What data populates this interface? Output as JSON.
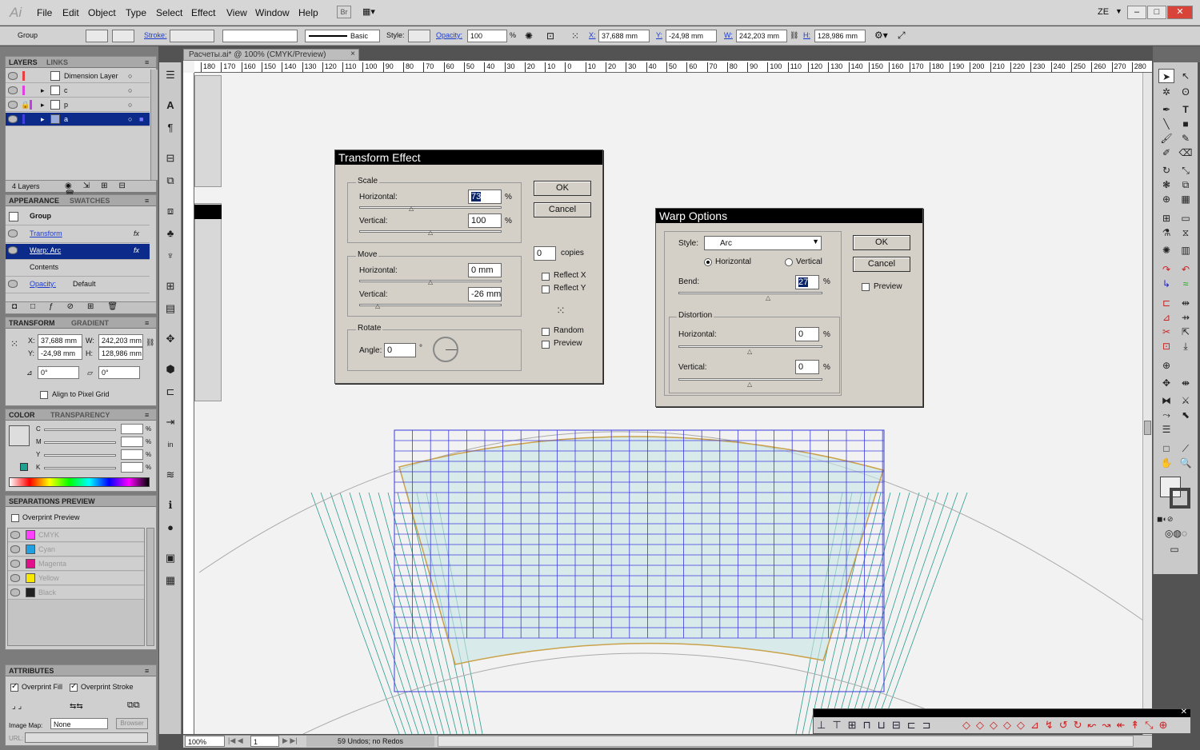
{
  "menubar": {
    "logo": "Ai",
    "items": [
      "File",
      "Edit",
      "Object",
      "Type",
      "Select",
      "Effect",
      "View",
      "Window",
      "Help"
    ],
    "workspace": "ZE",
    "br": "Br"
  },
  "control": {
    "selection": "Group",
    "stroke_label": "Stroke:",
    "style_label": "Style:",
    "stroke_profile": "Basic",
    "opacity_label": "Opacity:",
    "opacity": "100",
    "percent": "%",
    "x_label": "X:",
    "x": "37,688 mm",
    "y_label": "Y:",
    "y": "-24,98 mm",
    "w_label": "W:",
    "w": "242,203 mm",
    "h_label": "H:",
    "h": "128,986 mm"
  },
  "document": {
    "tab": "Расчеты.ai* @ 100% (CMYK/Preview)",
    "close": "×"
  },
  "ruler": {
    "labels": [
      "180",
      "170",
      "160",
      "150",
      "140",
      "130",
      "120",
      "110",
      "100",
      "90",
      "80",
      "70",
      "60",
      "50",
      "40",
      "30",
      "20",
      "10",
      "0",
      "10",
      "20",
      "30",
      "40",
      "50",
      "60",
      "70",
      "80",
      "90",
      "100",
      "110",
      "120",
      "130",
      "140",
      "150",
      "160",
      "170",
      "180",
      "190",
      "200",
      "210",
      "220",
      "230",
      "240",
      "250",
      "260",
      "270",
      "280"
    ]
  },
  "layers": {
    "tab1": "LAYERS",
    "tab2": "LINKS",
    "rows": [
      {
        "name": "Dimension Layer",
        "color": "#e84040"
      },
      {
        "name": "c",
        "color": "#e040e0"
      },
      {
        "name": "p",
        "color": "#c040e0"
      },
      {
        "name": "a",
        "color": "#4040e0"
      }
    ],
    "footer": "4 Layers"
  },
  "appearance": {
    "tab1": "APPEARANCE",
    "tab2": "SWATCHES",
    "group": "Group",
    "transform": "Transform",
    "warp": "Warp: Arc",
    "contents": "Contents",
    "opacity_label": "Opacity:",
    "opacity": "Default",
    "fx": "fx"
  },
  "transform": {
    "tab1": "TRANSFORM",
    "tab2": "GRADIENT",
    "x_label": "X:",
    "x": "37,688 mm",
    "y_label": "Y:",
    "y": "-24,98 mm",
    "w_label": "W:",
    "w": "242,203 mm",
    "h_label": "H:",
    "h": "128,986 mm",
    "angle": "0°",
    "shear": "0°",
    "align": "Align to Pixel Grid"
  },
  "color": {
    "tab1": "COLOR",
    "tab2": "TRANSPARENCY",
    "channels": [
      "C",
      "M",
      "Y",
      "K"
    ],
    "percent": "%"
  },
  "separations": {
    "title": "SEPARATIONS PREVIEW",
    "overprint": "Overprint Preview",
    "plates": [
      {
        "name": "CMYK",
        "color": "#ff40ff"
      },
      {
        "name": "Cyan",
        "color": "#20a0e0"
      },
      {
        "name": "Magenta",
        "color": "#e0108a"
      },
      {
        "name": "Yellow",
        "color": "#f8e800"
      },
      {
        "name": "Black",
        "color": "#222222"
      }
    ]
  },
  "attributes": {
    "title": "ATTRIBUTES",
    "overprint_fill": "Overprint Fill",
    "overprint_stroke": "Overprint Stroke",
    "image_map_label": "Image Map:",
    "image_map": "None",
    "browser": "Browser",
    "url": "URL:"
  },
  "transform_effect": {
    "title": "Transform Effect",
    "scale": "Scale",
    "horizontal": "Horizontal:",
    "vertical": "Vertical:",
    "scale_h": "73",
    "scale_v": "100",
    "pct": "%",
    "move": "Move",
    "move_h": "0 mm",
    "move_v": "-26 mm",
    "rotate": "Rotate",
    "angle_label": "Angle:",
    "angle": "0",
    "deg": "°",
    "ok": "OK",
    "cancel": "Cancel",
    "copies": "0",
    "copies_label": "copies",
    "reflect_x": "Reflect X",
    "reflect_y": "Reflect Y",
    "random": "Random",
    "preview": "Preview"
  },
  "warp_options": {
    "title": "Warp Options",
    "style_label": "Style:",
    "style": "Arc",
    "horizontal": "Horizontal",
    "vertical": "Vertical",
    "bend_label": "Bend:",
    "bend": "27",
    "pct": "%",
    "distortion": "Distortion",
    "dist_h_label": "Horizontal:",
    "dist_h": "0",
    "dist_v_label": "Vertical:",
    "dist_v": "0",
    "ok": "OK",
    "cancel": "Cancel",
    "preview": "Preview"
  },
  "status": {
    "zoom": "100%",
    "page": "1",
    "undo": "59 Undos; no Redos"
  }
}
